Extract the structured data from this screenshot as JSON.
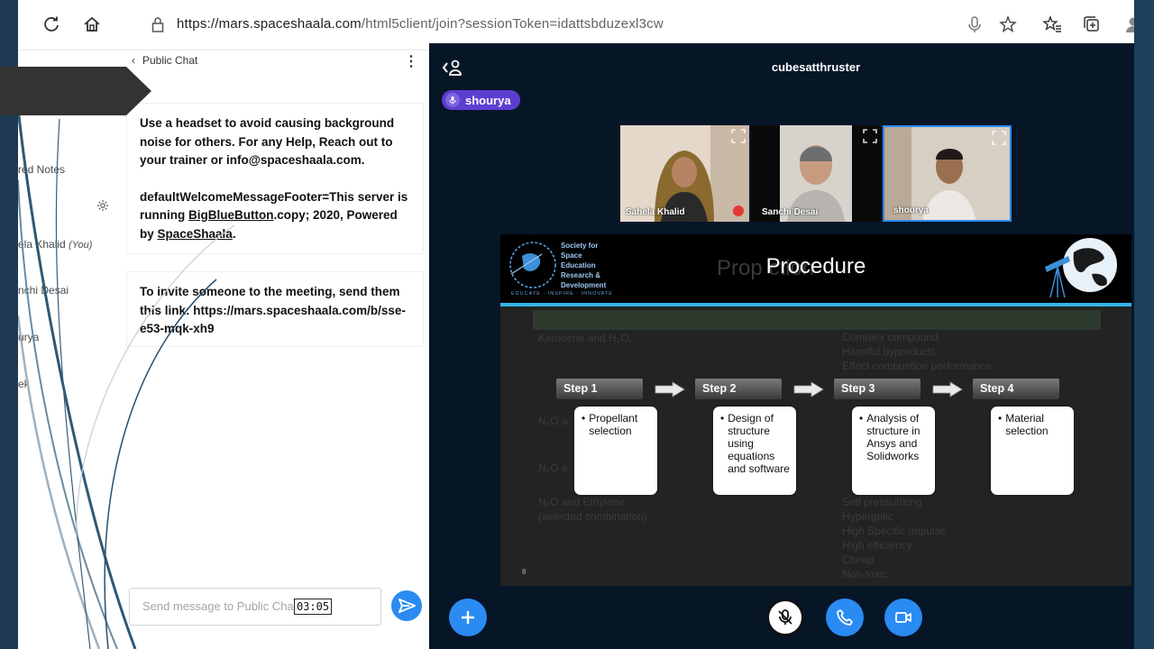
{
  "browser": {
    "url_host": "https://mars.spaceshaala.com",
    "url_path": "/html5client/join?sessionToken=idattsbduzexl3cw"
  },
  "user_list": {
    "items": [
      "red Notes",
      "ela Khalid",
      "(You)",
      "nchi Desai",
      "urya",
      "ek"
    ]
  },
  "chat": {
    "header": "Public Chat",
    "messages": {
      "welcome_line1": "Use a headset to avoid causing background noise for others. For any Help, Reach out to your trainer or info@spaceshaala.com.",
      "footer_prefix": "defaultWelcomeMessageFooter=This server is running ",
      "footer_link": "BigBlueButton",
      "footer_mid": ".copy; 2020, Powered by ",
      "footer_link2": "SpaceShaala",
      "footer_end": ".",
      "invite": "To invite someone to the meeting, send them this link: https://mars.spaceshaala.com/b/sse-e53-mqk-xh9"
    },
    "input_placeholder": "Send message to Public Cha",
    "timer": "03:05"
  },
  "session": {
    "title": "cubesatthruster",
    "presenter": "shourya"
  },
  "videos": [
    {
      "name": "Sahela Khalid"
    },
    {
      "name": "Sanchi Desai"
    },
    {
      "name": "shourya"
    }
  ],
  "slide": {
    "title": "Procedure",
    "ghost_title": "Prop                             ction",
    "org_lines": [
      "Society for",
      "Space",
      "Education",
      "Research &",
      "Development"
    ],
    "org_tagline": "EDUCATE · INSPIRE · INNOVATE",
    "page_number": "8",
    "ghost_lines": [
      "Kerosene and H₂O₂",
      "Complex compound",
      "Harmful byproducts",
      "Effect combustion performance",
      "N₂O a",
      "N₂O a",
      "N₂O and Ethylene",
      "(selected combination)",
      "Self pressurizing",
      "Hypergolic",
      "High Specific Impulse",
      "High efficiency",
      "Cheap",
      "Non-toxic"
    ],
    "steps": [
      {
        "label": "Step 1",
        "text": "Propellant selection"
      },
      {
        "label": "Step 2",
        "text": "Design of structure using equations and software"
      },
      {
        "label": "Step 3",
        "text": "Analysis of structure in Ansys and Solidworks"
      },
      {
        "label": "Step 4",
        "text": "Material selection"
      }
    ]
  },
  "colors": {
    "accent_blue": "#2a8bf2",
    "presenter_purple": "#5b3fd1",
    "main_bg": "#071627",
    "slide_rule": "#33b6e8"
  }
}
